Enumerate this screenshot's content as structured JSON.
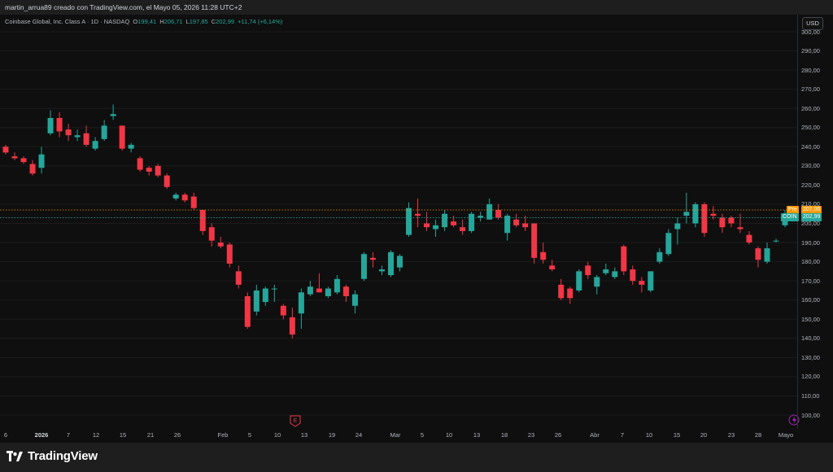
{
  "header": {
    "attribution": "martin_arrua89 creado con TradingView.com, el Mayo 05, 2026 11:28 UTC+2"
  },
  "legend": {
    "symbol": "Coinbase Global, Inc. Class A · 1D · NASDAQ",
    "open_label": "O",
    "open": "199,41",
    "high_label": "H",
    "high": "206,71",
    "low_label": "L",
    "low": "197,85",
    "close_label": "C",
    "close": "202,99",
    "change": "+11,74 (+6,14%)"
  },
  "currency": "USD",
  "price_axis": [
    "300,00",
    "290,00",
    "280,00",
    "270,00",
    "260,00",
    "250,00",
    "240,00",
    "230,00",
    "220,00",
    "210,00",
    "200,00",
    "190,00",
    "180,00",
    "170,00",
    "160,00",
    "150,00",
    "140,00",
    "130,00",
    "120,00",
    "110,00",
    "100,00"
  ],
  "time_axis": [
    {
      "label": "6",
      "bold": false
    },
    {
      "label": "2026",
      "bold": true
    },
    {
      "label": "7",
      "bold": false
    },
    {
      "label": "12",
      "bold": false
    },
    {
      "label": "15",
      "bold": false
    },
    {
      "label": "21",
      "bold": false
    },
    {
      "label": "26",
      "bold": false
    },
    {
      "label": "Feb",
      "bold": false
    },
    {
      "label": "5",
      "bold": false
    },
    {
      "label": "10",
      "bold": false
    },
    {
      "label": "13",
      "bold": false
    },
    {
      "label": "19",
      "bold": false
    },
    {
      "label": "24",
      "bold": false
    },
    {
      "label": "Mar",
      "bold": false
    },
    {
      "label": "5",
      "bold": false
    },
    {
      "label": "10",
      "bold": false
    },
    {
      "label": "13",
      "bold": false
    },
    {
      "label": "18",
      "bold": false
    },
    {
      "label": "23",
      "bold": false
    },
    {
      "label": "26",
      "bold": false
    },
    {
      "label": "Abr",
      "bold": false
    },
    {
      "label": "7",
      "bold": false
    },
    {
      "label": "10",
      "bold": false
    },
    {
      "label": "15",
      "bold": false
    },
    {
      "label": "20",
      "bold": false
    },
    {
      "label": "23",
      "bold": false
    },
    {
      "label": "28",
      "bold": false
    },
    {
      "label": "Mayo",
      "bold": false
    }
  ],
  "tags": {
    "pre_label": "Pre",
    "pre_value": "207,00",
    "coin_label": "COIN",
    "coin_value": "202,99"
  },
  "markers": {
    "earnings": "E"
  },
  "colors": {
    "up": "#26a69a",
    "down": "#f23645",
    "pre": "#ff9800",
    "background": "#0f0f0f"
  },
  "footer": {
    "brand": "TradingView"
  },
  "chart_data": {
    "type": "candlestick",
    "title": "Coinbase Global, Inc. Class A",
    "ylim": [
      100,
      300
    ],
    "candles": [
      {
        "d": "Jan 2",
        "o": 240,
        "h": 241,
        "l": 236,
        "c": 237
      },
      {
        "d": "Jan 5",
        "o": 235,
        "h": 237,
        "l": 233,
        "c": 234
      },
      {
        "d": "Jan 6",
        "o": 234,
        "h": 235,
        "l": 231,
        "c": 232
      },
      {
        "d": "Jan 7",
        "o": 231,
        "h": 233,
        "l": 225,
        "c": 226
      },
      {
        "d": "Jan 8",
        "o": 229,
        "h": 240,
        "l": 226,
        "c": 236
      },
      {
        "d": "Jan 9",
        "o": 247,
        "h": 259,
        "l": 246,
        "c": 255
      },
      {
        "d": "Jan 12",
        "o": 255,
        "h": 258,
        "l": 245,
        "c": 248
      },
      {
        "d": "Jan 13",
        "o": 249,
        "h": 252,
        "l": 243,
        "c": 246
      },
      {
        "d": "Jan 14",
        "o": 245,
        "h": 249,
        "l": 243,
        "c": 246
      },
      {
        "d": "Jan 15",
        "o": 247,
        "h": 251,
        "l": 240,
        "c": 241
      },
      {
        "d": "Jan 16",
        "o": 239,
        "h": 245,
        "l": 238,
        "c": 243
      },
      {
        "d": "Jan 19",
        "o": 244,
        "h": 254,
        "l": 243,
        "c": 251
      },
      {
        "d": "Jan 20",
        "o": 256,
        "h": 262,
        "l": 254,
        "c": 257
      },
      {
        "d": "Jan 21",
        "o": 251,
        "h": 251,
        "l": 238,
        "c": 239
      },
      {
        "d": "Jan 22",
        "o": 239,
        "h": 242,
        "l": 237,
        "c": 241
      },
      {
        "d": "Jan 23",
        "o": 234,
        "h": 235,
        "l": 227,
        "c": 228
      },
      {
        "d": "Jan 26",
        "o": 229,
        "h": 230,
        "l": 225,
        "c": 227
      },
      {
        "d": "Jan 27",
        "o": 230,
        "h": 231,
        "l": 224,
        "c": 225
      },
      {
        "d": "Jan 28",
        "o": 225,
        "h": 226,
        "l": 218,
        "c": 219
      },
      {
        "d": "Jan 29",
        "o": 213,
        "h": 216,
        "l": 212,
        "c": 215
      },
      {
        "d": "Jan 30",
        "o": 215,
        "h": 216,
        "l": 211,
        "c": 212
      },
      {
        "d": "Feb 2",
        "o": 214,
        "h": 216,
        "l": 207,
        "c": 208
      },
      {
        "d": "Feb 3",
        "o": 207,
        "h": 207,
        "l": 194,
        "c": 196
      },
      {
        "d": "Feb 4",
        "o": 198,
        "h": 200,
        "l": 188,
        "c": 191
      },
      {
        "d": "Feb 5",
        "o": 190,
        "h": 193,
        "l": 187,
        "c": 188
      },
      {
        "d": "Feb 6",
        "o": 189,
        "h": 190,
        "l": 177,
        "c": 179
      },
      {
        "d": "Feb 9",
        "o": 175,
        "h": 178,
        "l": 166,
        "c": 168
      },
      {
        "d": "Feb 10",
        "o": 162,
        "h": 164,
        "l": 145,
        "c": 146
      },
      {
        "d": "Feb 11",
        "o": 154,
        "h": 168,
        "l": 152,
        "c": 165
      },
      {
        "d": "Feb 12",
        "o": 159,
        "h": 167,
        "l": 157,
        "c": 166
      },
      {
        "d": "Feb 13",
        "o": 166,
        "h": 168,
        "l": 159,
        "c": 166
      },
      {
        "d": "Feb 17",
        "o": 157,
        "h": 158,
        "l": 150,
        "c": 152
      },
      {
        "d": "Feb 18",
        "o": 151,
        "h": 156,
        "l": 140,
        "c": 142
      },
      {
        "d": "Feb 19",
        "o": 153,
        "h": 166,
        "l": 145,
        "c": 164
      },
      {
        "d": "Feb 20",
        "o": 163,
        "h": 170,
        "l": 162,
        "c": 167
      },
      {
        "d": "Feb 23",
        "o": 166,
        "h": 174,
        "l": 164,
        "c": 164
      },
      {
        "d": "Feb 24",
        "o": 162,
        "h": 167,
        "l": 161,
        "c": 166
      },
      {
        "d": "Feb 25",
        "o": 164,
        "h": 173,
        "l": 163,
        "c": 171
      },
      {
        "d": "Feb 26",
        "o": 167,
        "h": 168,
        "l": 159,
        "c": 162
      },
      {
        "d": "Feb 27",
        "o": 157,
        "h": 165,
        "l": 153,
        "c": 163
      },
      {
        "d": "Mar 2",
        "o": 171,
        "h": 185,
        "l": 170,
        "c": 184
      },
      {
        "d": "Mar 3",
        "o": 182,
        "h": 185,
        "l": 177,
        "c": 181
      },
      {
        "d": "Mar 4",
        "o": 175,
        "h": 178,
        "l": 173,
        "c": 176
      },
      {
        "d": "Mar 5",
        "o": 173,
        "h": 186,
        "l": 172,
        "c": 185
      },
      {
        "d": "Mar 6",
        "o": 177,
        "h": 184,
        "l": 175,
        "c": 183
      },
      {
        "d": "Mar 9",
        "o": 194,
        "h": 211,
        "l": 193,
        "c": 208
      },
      {
        "d": "Mar 10",
        "o": 205,
        "h": 213,
        "l": 198,
        "c": 204
      },
      {
        "d": "Mar 11",
        "o": 200,
        "h": 206,
        "l": 196,
        "c": 198
      },
      {
        "d": "Mar 12",
        "o": 197,
        "h": 202,
        "l": 193,
        "c": 199
      },
      {
        "d": "Mar 13",
        "o": 198,
        "h": 207,
        "l": 196,
        "c": 205
      },
      {
        "d": "Mar 16",
        "o": 201,
        "h": 204,
        "l": 198,
        "c": 199
      },
      {
        "d": "Mar 17",
        "o": 198,
        "h": 202,
        "l": 194,
        "c": 196
      },
      {
        "d": "Mar 18",
        "o": 196,
        "h": 206,
        "l": 195,
        "c": 205
      },
      {
        "d": "Mar 19",
        "o": 203,
        "h": 206,
        "l": 201,
        "c": 204
      },
      {
        "d": "Mar 20",
        "o": 202,
        "h": 213,
        "l": 202,
        "c": 210
      },
      {
        "d": "Mar 23",
        "o": 207,
        "h": 210,
        "l": 202,
        "c": 203
      },
      {
        "d": "Mar 24",
        "o": 195,
        "h": 205,
        "l": 191,
        "c": 204
      },
      {
        "d": "Mar 25",
        "o": 202,
        "h": 205,
        "l": 198,
        "c": 199
      },
      {
        "d": "Mar 26",
        "o": 200,
        "h": 204,
        "l": 196,
        "c": 198
      },
      {
        "d": "Mar 27",
        "o": 200,
        "h": 200,
        "l": 179,
        "c": 182
      },
      {
        "d": "Mar 30",
        "o": 185,
        "h": 190,
        "l": 179,
        "c": 181
      },
      {
        "d": "Mar 31",
        "o": 178,
        "h": 181,
        "l": 175,
        "c": 176
      },
      {
        "d": "Abr 1",
        "o": 168,
        "h": 171,
        "l": 160,
        "c": 161
      },
      {
        "d": "Abr 2",
        "o": 166,
        "h": 167,
        "l": 158,
        "c": 161
      },
      {
        "d": "Abr 6",
        "o": 165,
        "h": 176,
        "l": 164,
        "c": 175
      },
      {
        "d": "Abr 7",
        "o": 178,
        "h": 180,
        "l": 171,
        "c": 173
      },
      {
        "d": "Abr 8",
        "o": 167,
        "h": 173,
        "l": 163,
        "c": 172
      },
      {
        "d": "Abr 9",
        "o": 174,
        "h": 179,
        "l": 173,
        "c": 176
      },
      {
        "d": "Abr 10",
        "o": 172,
        "h": 177,
        "l": 171,
        "c": 175
      },
      {
        "d": "Abr 13",
        "o": 188,
        "h": 189,
        "l": 173,
        "c": 175
      },
      {
        "d": "Abr 14",
        "o": 176,
        "h": 178,
        "l": 168,
        "c": 170
      },
      {
        "d": "Abr 15",
        "o": 170,
        "h": 172,
        "l": 164,
        "c": 168
      },
      {
        "d": "Abr 16",
        "o": 165,
        "h": 175,
        "l": 164,
        "c": 175
      },
      {
        "d": "Abr 17",
        "o": 180,
        "h": 187,
        "l": 179,
        "c": 185
      },
      {
        "d": "Abr 20",
        "o": 184,
        "h": 197,
        "l": 183,
        "c": 195
      },
      {
        "d": "Abr 21",
        "o": 197,
        "h": 203,
        "l": 189,
        "c": 200
      },
      {
        "d": "Abr 22",
        "o": 204,
        "h": 216,
        "l": 200,
        "c": 206
      },
      {
        "d": "Abr 23",
        "o": 200,
        "h": 211,
        "l": 198,
        "c": 210
      },
      {
        "d": "Abr 24",
        "o": 210,
        "h": 211,
        "l": 193,
        "c": 195
      },
      {
        "d": "Abr 27",
        "o": 205,
        "h": 209,
        "l": 202,
        "c": 204
      },
      {
        "d": "Abr 28",
        "o": 203,
        "h": 205,
        "l": 195,
        "c": 198
      },
      {
        "d": "Abr 29",
        "o": 203,
        "h": 204,
        "l": 198,
        "c": 200
      },
      {
        "d": "Abr 30",
        "o": 198,
        "h": 205,
        "l": 195,
        "c": 197
      },
      {
        "d": "May 1",
        "o": 194,
        "h": 196,
        "l": 189,
        "c": 190
      },
      {
        "d": "May 4",
        "o": 187,
        "h": 188,
        "l": 177,
        "c": 181
      },
      {
        "d": "May 5",
        "o": 180,
        "h": 190,
        "l": 179,
        "c": 187
      },
      {
        "d": "May 6",
        "o": 191,
        "h": 192,
        "l": 190,
        "c": 191
      },
      {
        "d": "May 7",
        "o": 199,
        "h": 207,
        "l": 198,
        "c": 203
      }
    ],
    "lines": [
      {
        "name": "Pre",
        "value": 207.0,
        "color": "#ff9800"
      },
      {
        "name": "COIN",
        "value": 202.99,
        "color": "#26a69a"
      }
    ]
  }
}
